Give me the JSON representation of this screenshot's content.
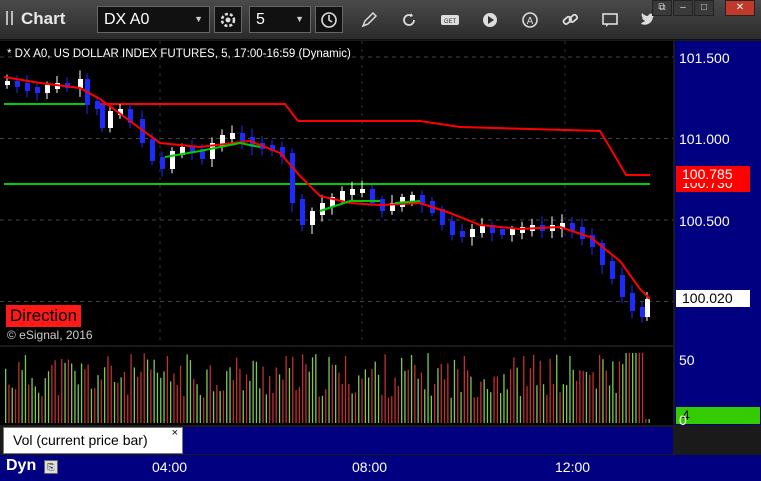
{
  "window": {
    "title": "Chart",
    "symbol": "DX A0",
    "interval": "5",
    "controls": {
      "restore": "⧉",
      "minimize": "–",
      "maximize": "□",
      "close": "✕"
    }
  },
  "toolbar": {
    "icons": [
      "settings-gear-icon",
      "clock-icon",
      "pencil-icon",
      "refresh-icon",
      "get-icon",
      "play-icon",
      "a-icon",
      "link-icon",
      "comment-icon",
      "twitter-icon"
    ]
  },
  "chart": {
    "header": "* DX A0, US DOLLAR INDEX FUTURES, 5, 17:00-16:59 (Dynamic)",
    "watermark": "© eSignal, 2016",
    "study_label": "Direction",
    "price_axis": [
      "101.500",
      "101.000",
      "100.500"
    ],
    "price_tags": {
      "upper": "100.785",
      "upper_hidden": "100.730",
      "last": "100.020"
    },
    "volume_axis": [
      "50",
      "0"
    ],
    "volume_tag": "4",
    "time_labels": [
      "04:00",
      "08:00",
      "12:00"
    ],
    "mode_label": "Dyn",
    "colors": {
      "up": "#ffffff",
      "down": "#1e2bff",
      "ma": "#ff0000",
      "ma_up": "#00cc00",
      "level_red": "#ff0000",
      "level_green": "#00cc00",
      "vol_up": "#7ec850",
      "vol_down": "#c03030",
      "scale": "#000080"
    }
  },
  "volume_panel": {
    "label": "Vol (current price bar)",
    "close": "×"
  },
  "chart_data": {
    "type": "candlestick",
    "y_range": [
      99.75,
      101.67
    ],
    "levels": [
      {
        "value": 101.22,
        "color": "green",
        "extent": "start"
      },
      {
        "value": 100.73,
        "color": "green"
      },
      {
        "value": 100.75,
        "color": "red"
      }
    ],
    "last_price": 100.02,
    "ma_label_value": 100.785
  }
}
